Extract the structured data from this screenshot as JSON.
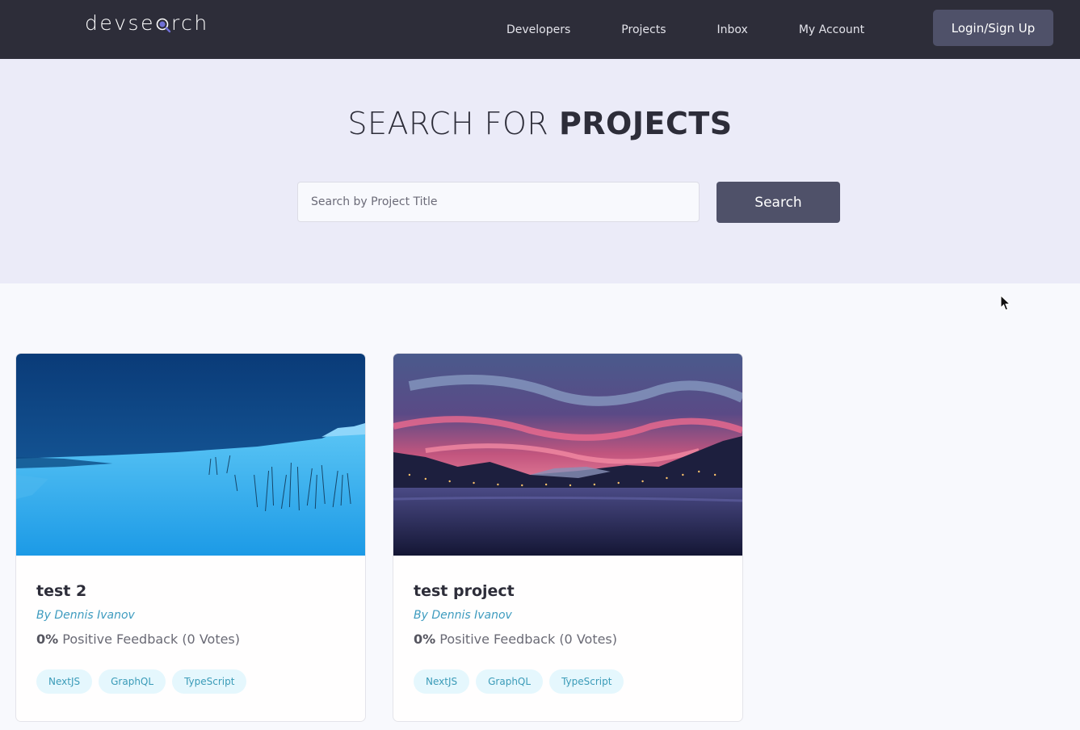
{
  "header": {
    "logo_prefix": "devse",
    "logo_suffix": "rch",
    "nav": [
      "Developers",
      "Projects",
      "Inbox",
      "My Account"
    ],
    "login_label": "Login/Sign Up"
  },
  "hero": {
    "title_light": "SEARCH FOR",
    "title_bold": "PROJECTS",
    "search_placeholder": "Search by Project Title",
    "search_button": "Search"
  },
  "projects": [
    {
      "title": "test 2",
      "author": "By Dennis Ivanov",
      "feedback_percent": "0%",
      "feedback_text": "Positive Feedback (0 Votes)",
      "tags": [
        "NextJS",
        "GraphQL",
        "TypeScript"
      ],
      "image": "snowy-coast-photo"
    },
    {
      "title": "test project",
      "author": "By Dennis Ivanov",
      "feedback_percent": "0%",
      "feedback_text": "Positive Feedback (0 Votes)",
      "tags": [
        "NextJS",
        "GraphQL",
        "TypeScript"
      ],
      "image": "sunset-lake-photo"
    }
  ],
  "colors": {
    "header_bg": "#2d2d39",
    "hero_bg": "#ebebf8",
    "button_bg": "#4f5169",
    "author_link": "#3d9bbf",
    "tag_bg": "#e5f7fd"
  }
}
